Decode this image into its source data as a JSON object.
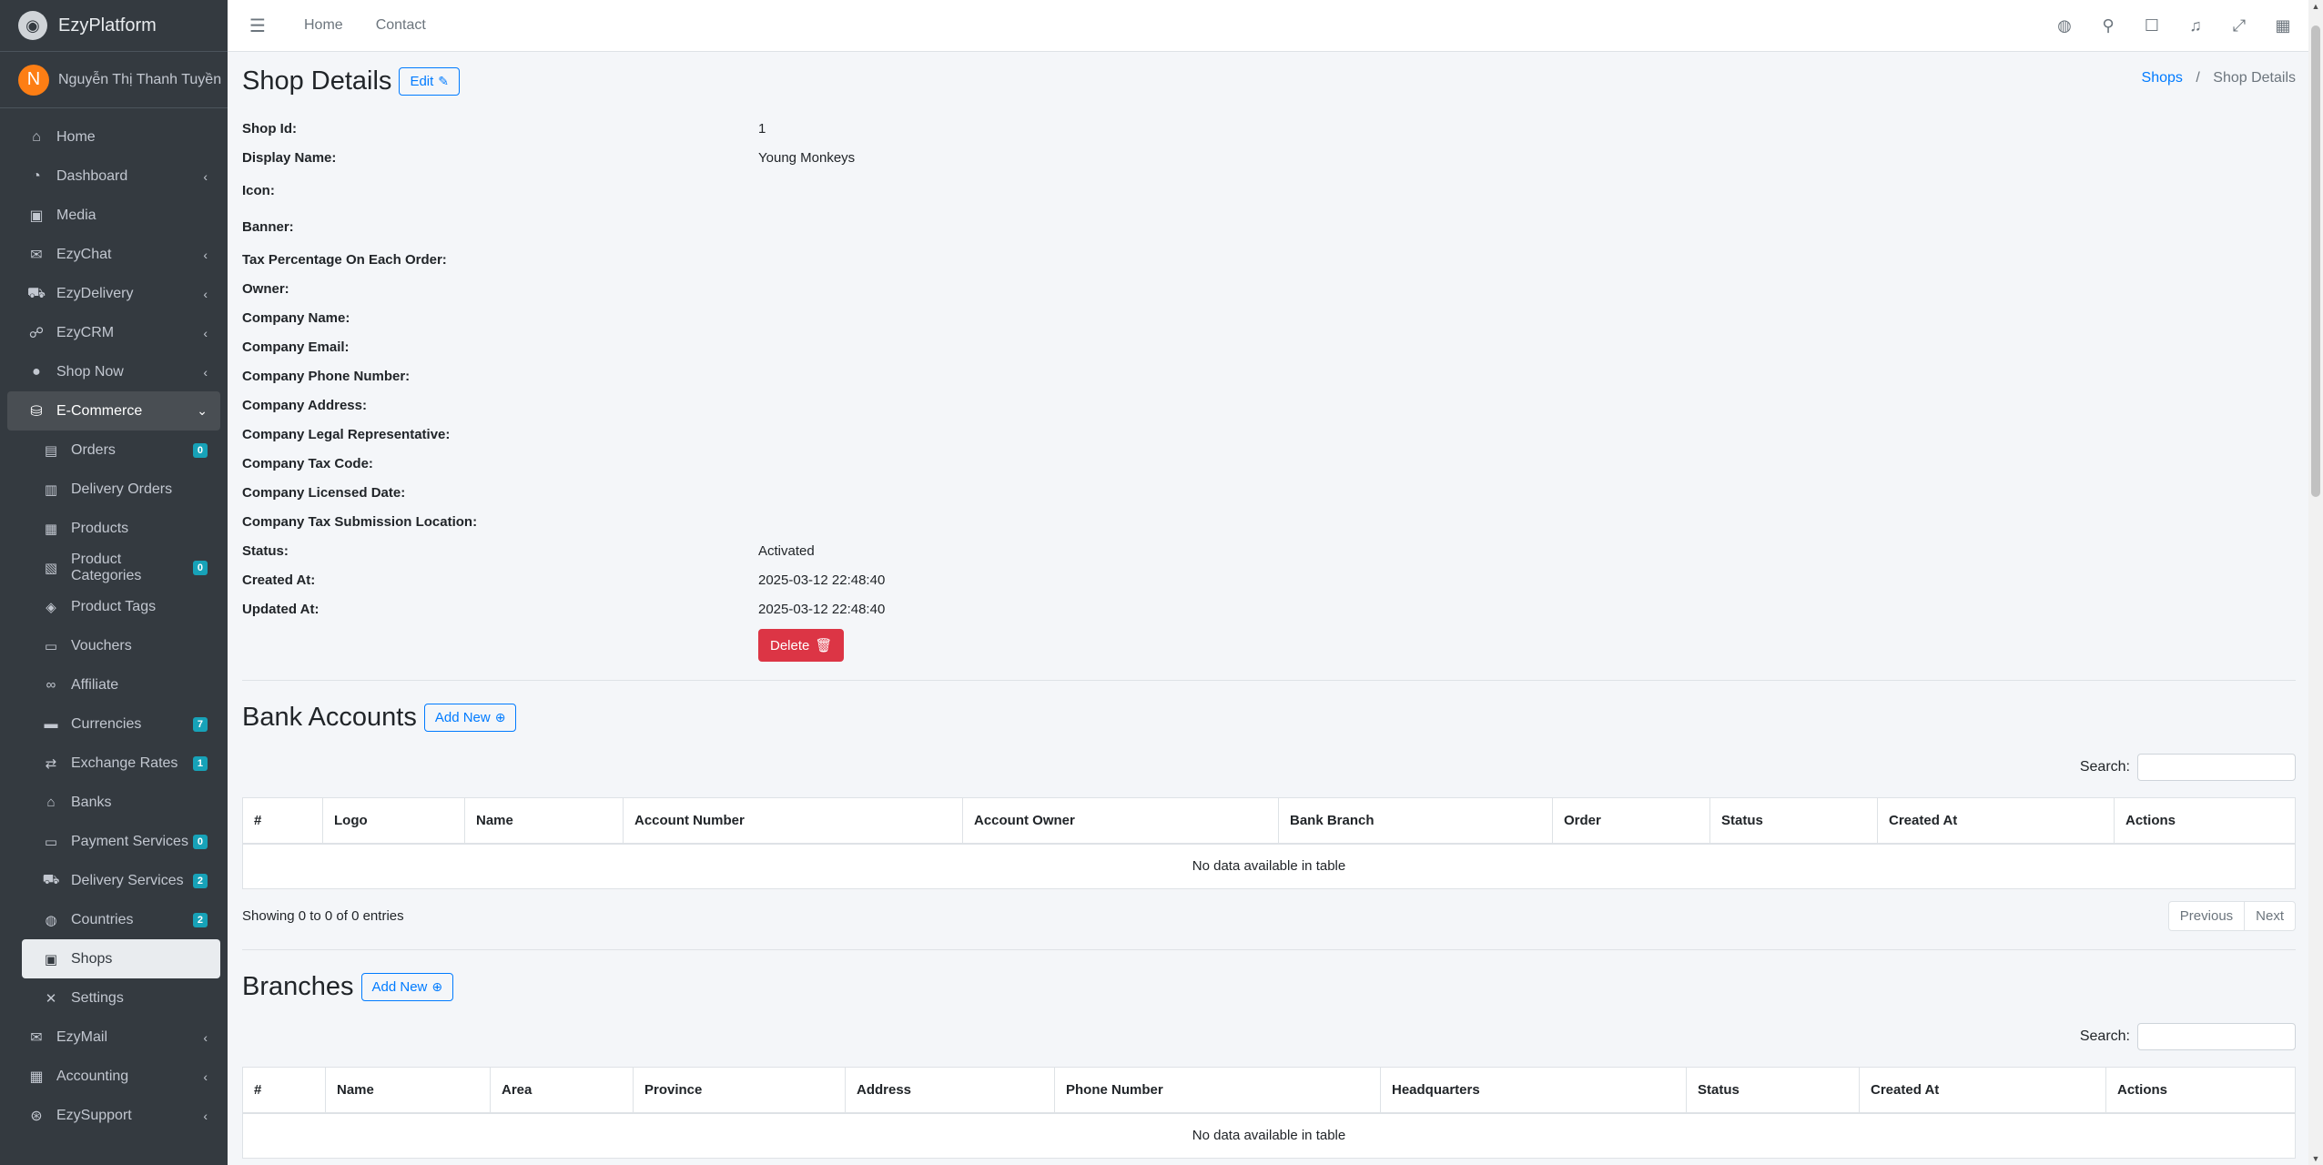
{
  "brand": {
    "name": "EzyPlatform"
  },
  "user": {
    "initial": "N",
    "name": "Nguyễn Thị Thanh Tuyền"
  },
  "sidebar": {
    "items": [
      {
        "label": "Home"
      },
      {
        "label": "Dashboard"
      },
      {
        "label": "Media"
      },
      {
        "label": "EzyChat"
      },
      {
        "label": "EzyDelivery"
      },
      {
        "label": "EzyCRM"
      },
      {
        "label": "Shop Now"
      },
      {
        "label": "E-Commerce"
      }
    ],
    "ecommerce_sub": [
      {
        "label": "Orders",
        "badge": "0"
      },
      {
        "label": "Delivery Orders"
      },
      {
        "label": "Products"
      },
      {
        "label": "Product Categories",
        "badge": "0"
      },
      {
        "label": "Product Tags"
      },
      {
        "label": "Vouchers"
      },
      {
        "label": "Affiliate"
      },
      {
        "label": "Currencies",
        "badge": "7"
      },
      {
        "label": "Exchange Rates",
        "badge": "1"
      },
      {
        "label": "Banks"
      },
      {
        "label": "Payment Services",
        "badge": "0"
      },
      {
        "label": "Delivery Services",
        "badge": "2"
      },
      {
        "label": "Countries",
        "badge": "2"
      },
      {
        "label": "Shops"
      },
      {
        "label": "Settings"
      }
    ],
    "after": [
      {
        "label": "EzyMail"
      },
      {
        "label": "Accounting"
      },
      {
        "label": "EzySupport"
      }
    ]
  },
  "topbar": {
    "home": "Home",
    "contact": "Contact"
  },
  "page": {
    "title": "Shop Details",
    "edit_label": "Edit",
    "breadcrumb": {
      "parent": "Shops",
      "separator": "/",
      "current": "Shop Details"
    }
  },
  "details": {
    "shop_id": {
      "label": "Shop Id:",
      "value": "1"
    },
    "display_name": {
      "label": "Display Name:",
      "value": "Young Monkeys"
    },
    "icon": {
      "label": "Icon:"
    },
    "banner": {
      "label": "Banner:"
    },
    "tax": {
      "label": "Tax Percentage On Each Order:"
    },
    "owner": {
      "label": "Owner:"
    },
    "company_name": {
      "label": "Company Name:"
    },
    "company_email": {
      "label": "Company Email:"
    },
    "company_phone": {
      "label": "Company Phone Number:"
    },
    "company_address": {
      "label": "Company Address:"
    },
    "company_legal": {
      "label": "Company Legal Representative:"
    },
    "company_tax_code": {
      "label": "Company Tax Code:"
    },
    "company_licensed": {
      "label": "Company Licensed Date:"
    },
    "company_tax_location": {
      "label": "Company Tax Submission Location:"
    },
    "status": {
      "label": "Status:",
      "value": "Activated"
    },
    "created_at": {
      "label": "Created At:",
      "value": "2025-03-12 22:48:40"
    },
    "updated_at": {
      "label": "Updated At:",
      "value": "2025-03-12 22:48:40"
    },
    "delete_label": "Delete"
  },
  "bank_accounts": {
    "title": "Bank Accounts",
    "add_label": "Add New",
    "search_label": "Search:",
    "columns": [
      "#",
      "Logo",
      "Name",
      "Account Number",
      "Account Owner",
      "Bank Branch",
      "Order",
      "Status",
      "Created At",
      "Actions"
    ],
    "empty": "No data available in table",
    "info": "Showing 0 to 0 of 0 entries",
    "prev": "Previous",
    "next": "Next"
  },
  "branches": {
    "title": "Branches",
    "add_label": "Add New",
    "search_label": "Search:",
    "columns": [
      "#",
      "Name",
      "Area",
      "Province",
      "Address",
      "Phone Number",
      "Headquarters",
      "Status",
      "Created At",
      "Actions"
    ],
    "empty": "No data available in table"
  }
}
